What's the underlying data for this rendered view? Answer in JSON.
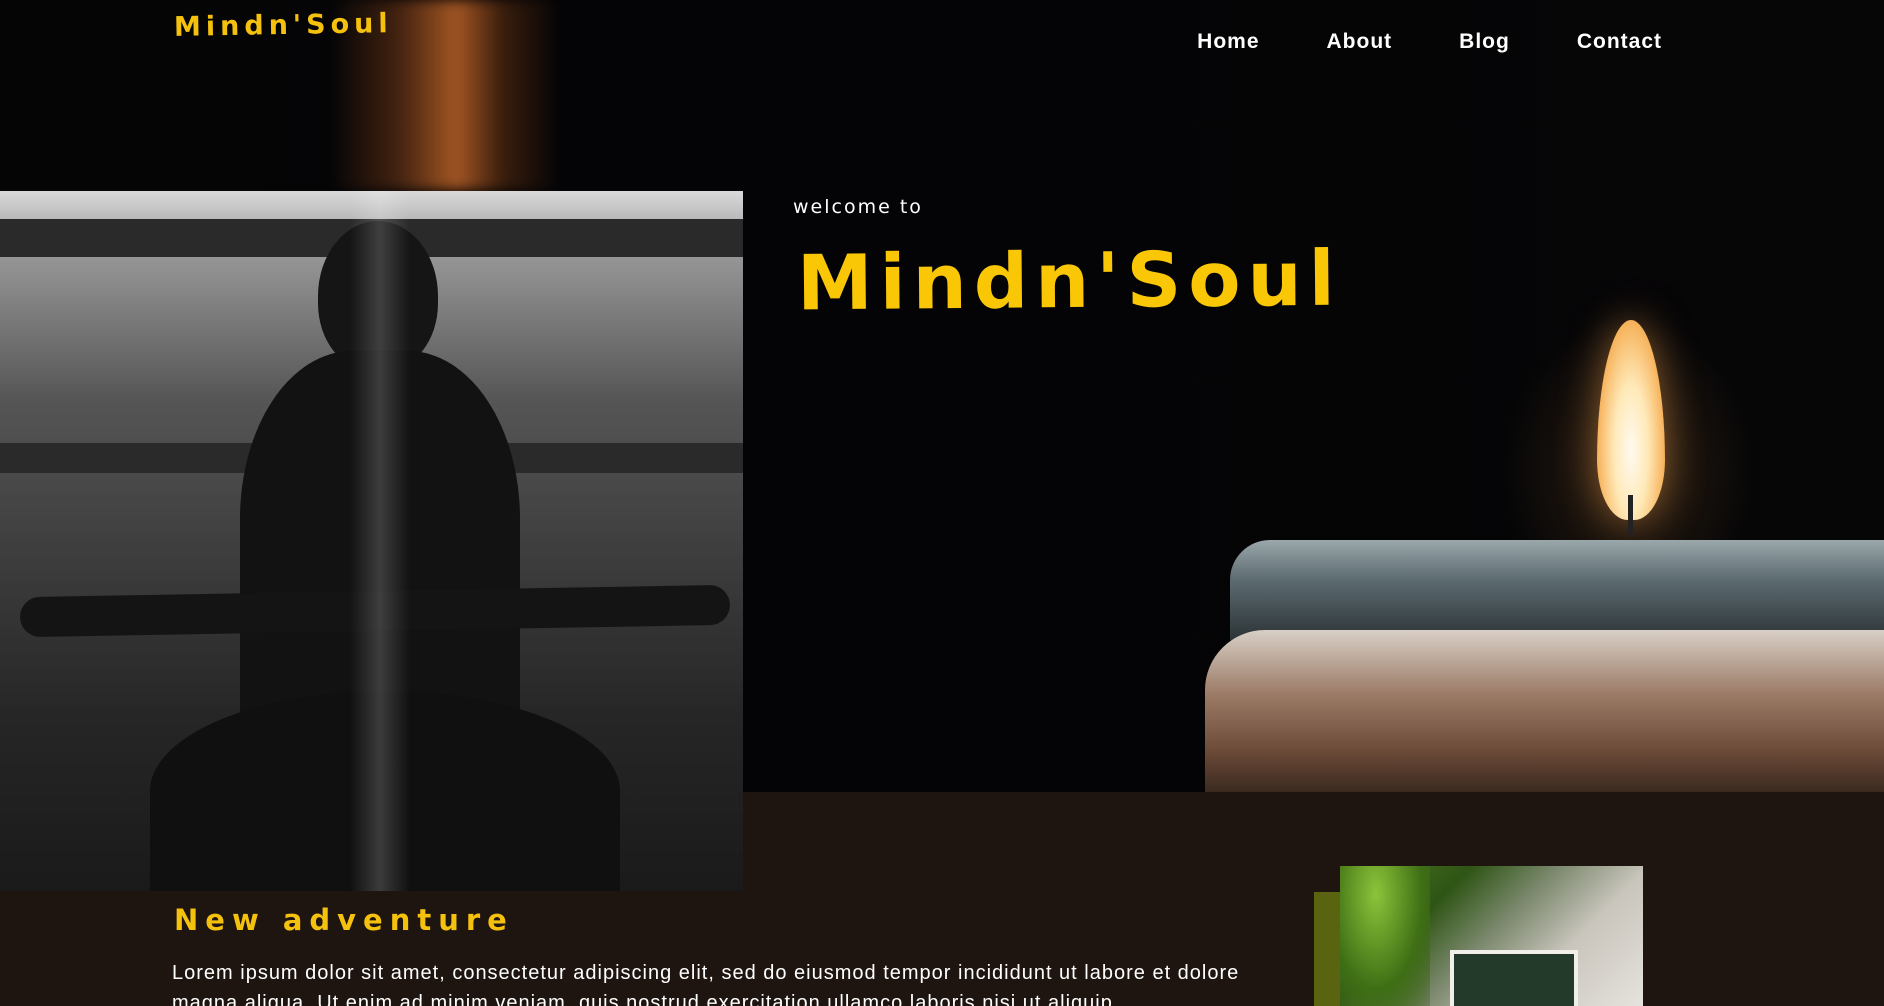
{
  "header": {
    "logo": "Mindn'Soul",
    "nav": [
      {
        "label": "Home"
      },
      {
        "label": "About"
      },
      {
        "label": "Blog"
      },
      {
        "label": "Contact"
      }
    ]
  },
  "hero": {
    "welcome": "welcome to",
    "title": "Mindn'Soul"
  },
  "section": {
    "title": "New adventure",
    "text": "Lorem ipsum dolor sit amet, consectetur adipiscing elit, sed do eiusmod tempor incididunt ut labore et dolore magna aliqua. Ut enim ad minim veniam, quis nostrud exercitation ullamco laboris nisi ut aliquip"
  },
  "colors": {
    "accent": "#f4c20d",
    "background": "#1e1410",
    "hero_bg": "#050506"
  },
  "images": {
    "yoga": "meditation-photo",
    "candle": "candle-photo",
    "house": "house-photo"
  }
}
